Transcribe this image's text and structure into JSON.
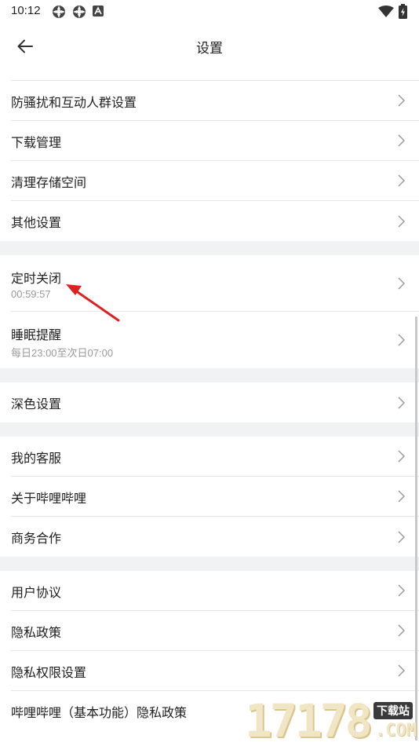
{
  "status_bar": {
    "time": "10:12",
    "left_icons": [
      "app-notification-icon",
      "app-notification-icon",
      "a-notification-icon"
    ],
    "right_icons": [
      "wifi-icon",
      "battery-charging-icon"
    ]
  },
  "app_bar": {
    "back_icon": "arrow-left-icon",
    "title": "设置"
  },
  "groups": [
    {
      "items": [
        {
          "label": "防骚扰和互动人群设置"
        },
        {
          "label": "下载管理"
        },
        {
          "label": "清理存储空间"
        },
        {
          "label": "其他设置"
        }
      ]
    },
    {
      "items": [
        {
          "label": "定时关闭",
          "sub": "00:59:57"
        },
        {
          "label": "睡眠提醒",
          "sub": "每日23:00至次日07:00"
        }
      ]
    },
    {
      "items": [
        {
          "label": "深色设置"
        }
      ]
    },
    {
      "items": [
        {
          "label": "我的客服"
        },
        {
          "label": "关于哔哩哔哩"
        },
        {
          "label": "商务合作"
        }
      ]
    },
    {
      "items": [
        {
          "label": "用户协议"
        },
        {
          "label": "隐私政策"
        },
        {
          "label": "隐私权限设置"
        },
        {
          "label": "哔哩哔哩（基本功能）隐私政策"
        }
      ]
    }
  ],
  "annotation": {
    "color": "#e02020"
  },
  "watermark": {
    "number": "17178",
    "tag": "下载站",
    "domain": ".COM"
  }
}
